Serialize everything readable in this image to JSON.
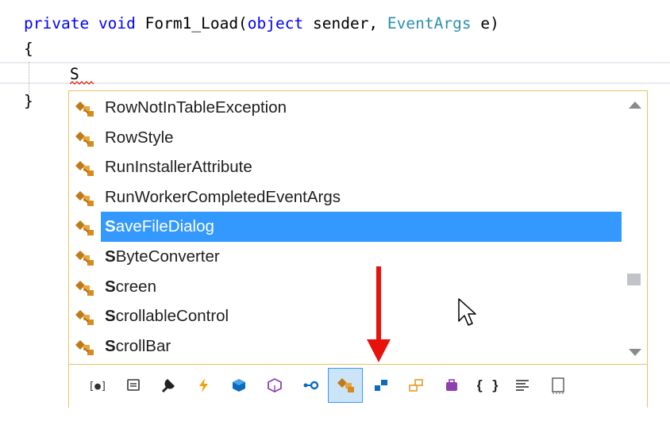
{
  "editor": {
    "line1": {
      "kw_private": "private",
      "kw_void": "void",
      "method": "Form1_Load(",
      "kw_object": "object",
      "param1": " sender, ",
      "type_eventargs": "EventArgs",
      "param2": " e)"
    },
    "open_brace": "{",
    "typed_text": "S",
    "close_brace": "}"
  },
  "completion": {
    "items": [
      {
        "match": "",
        "rest": "RowNotInTableException",
        "icon": "class-icon"
      },
      {
        "match": "",
        "rest": "RowStyle",
        "icon": "class-icon"
      },
      {
        "match": "",
        "rest": "RunInstallerAttribute",
        "icon": "class-icon"
      },
      {
        "match": "",
        "rest": "RunWorkerCompletedEventArgs",
        "icon": "class-icon"
      },
      {
        "match": "S",
        "rest": "aveFileDialog",
        "icon": "class-icon",
        "selected": true
      },
      {
        "match": "S",
        "rest": "ByteConverter",
        "icon": "class-icon"
      },
      {
        "match": "S",
        "rest": "creen",
        "icon": "class-icon"
      },
      {
        "match": "S",
        "rest": "crollableControl",
        "icon": "class-icon"
      },
      {
        "match": "S",
        "rest": "crollBar",
        "icon": "class-icon"
      }
    ],
    "filters": [
      {
        "name": "namespace-filter-icon"
      },
      {
        "name": "property-filter-icon"
      },
      {
        "name": "method-wrench-filter-icon"
      },
      {
        "name": "event-filter-icon"
      },
      {
        "name": "field-filter-icon"
      },
      {
        "name": "struct-filter-icon"
      },
      {
        "name": "delegate-filter-icon"
      },
      {
        "name": "class-filter-icon",
        "active": true
      },
      {
        "name": "interface-filter-icon"
      },
      {
        "name": "enum-filter-icon"
      },
      {
        "name": "module-filter-icon"
      },
      {
        "name": "keyword-braces-filter-icon"
      },
      {
        "name": "snippet-filter-icon"
      },
      {
        "name": "target-type-filter-icon"
      }
    ],
    "filter_braces_glyph": "{ }"
  },
  "colors": {
    "keyword": "#0000ff",
    "type": "#2b91af",
    "selection": "#3399ff",
    "popup_border": "#e5c365",
    "class_icon": "#d68a1f",
    "annotation_arrow": "#e8120c"
  }
}
